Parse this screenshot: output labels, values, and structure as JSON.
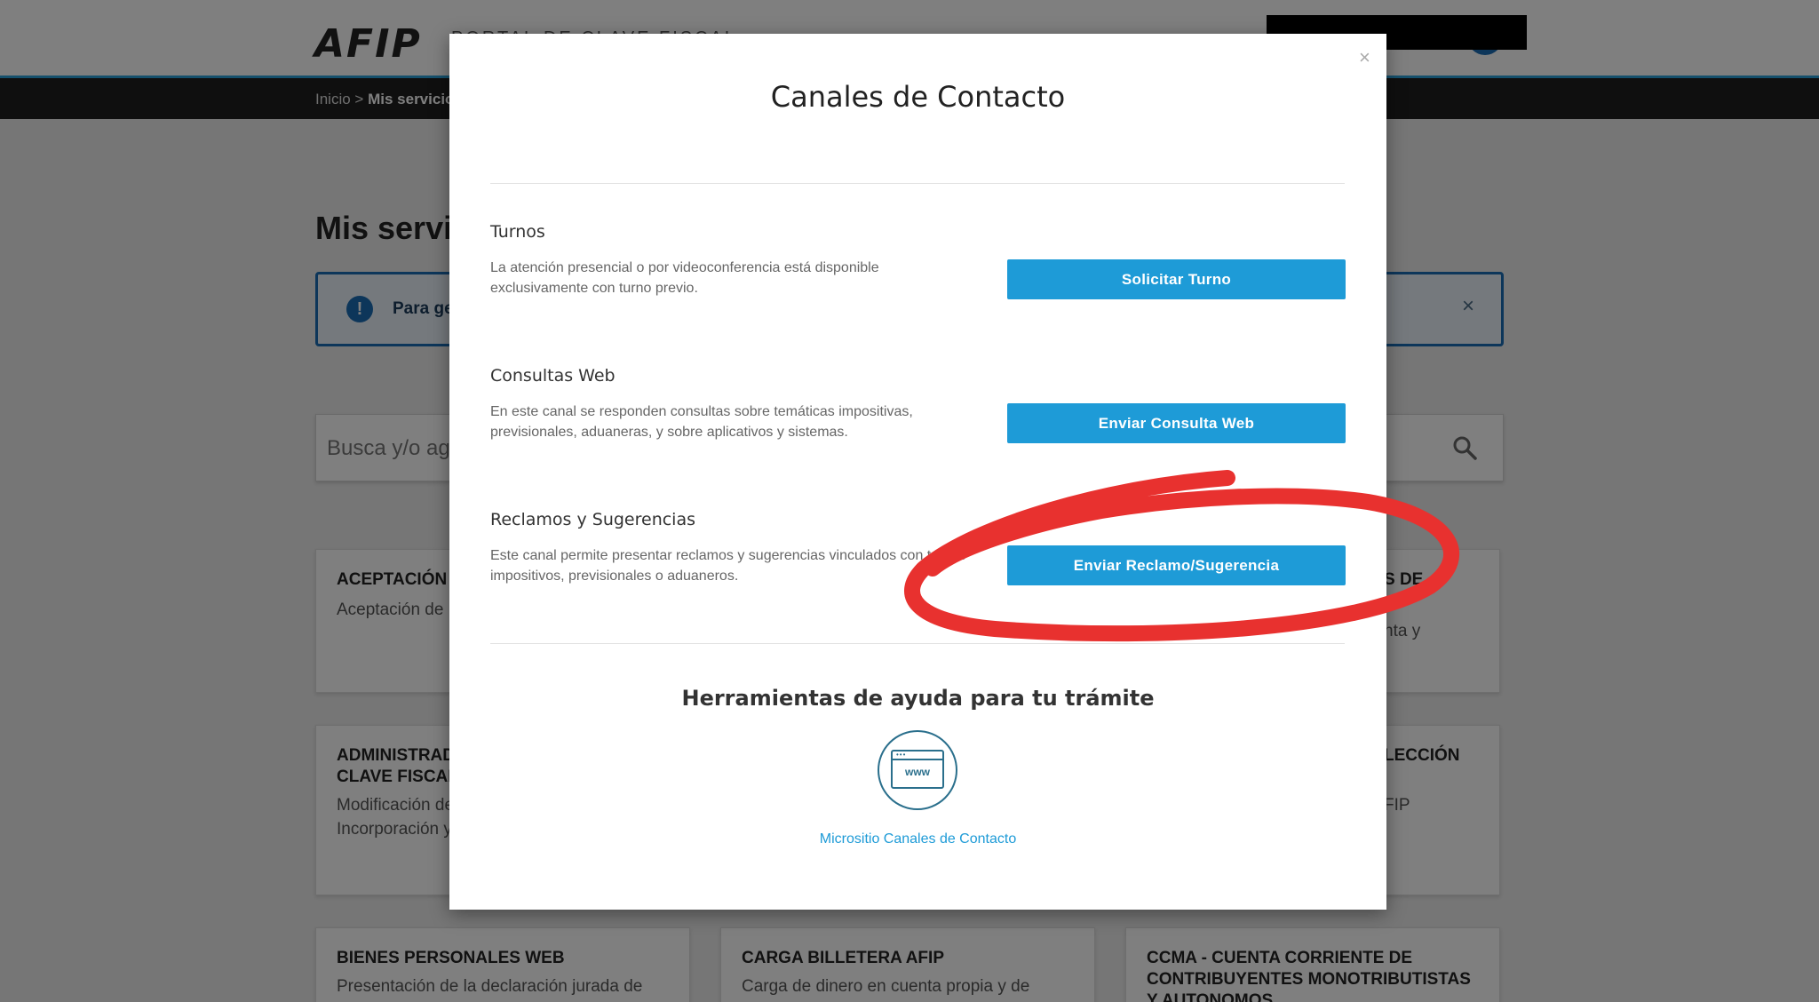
{
  "header": {
    "logo": "AFIP",
    "portal_title": "PORTAL DE CLAVE FISCAL"
  },
  "breadcrumb": {
    "home": "Inicio",
    "separator": ">",
    "current": "Mis servicios"
  },
  "page": {
    "title": "Mis servicios",
    "info_text": "Para ge",
    "info_close": "×",
    "search_placeholder": "Busca y/o ag"
  },
  "cards": [
    {
      "title": "ACEPTACIÓN",
      "desc": "Aceptación de"
    },
    {
      "title": "S DE",
      "desc": "nta y"
    },
    {
      "title": "ADMINISTRADOR DE RELACIONES DE CLAVE FISCAL",
      "desc": "Modificación de perfil. Incorporación y"
    },
    {
      "title": "LECCIÓN",
      "desc": "FIP"
    },
    {
      "title": "BIENES PERSONALES WEB",
      "desc": "Presentación de la declaración jurada de"
    },
    {
      "title": "CARGA BILLETERA AFIP",
      "desc": "Carga de dinero en cuenta propia y de"
    },
    {
      "title": "CCMA - CUENTA CORRIENTE DE CONTRIBUYENTES MONOTRIBUTISTAS Y AUTONOMOS",
      "desc": ""
    }
  ],
  "modal": {
    "title": "Canales de Contacto",
    "close": "×",
    "sections": [
      {
        "title": "Turnos",
        "desc": "La atención presencial o por videoconferencia está disponible exclusivamente con turno previo.",
        "button": "Solicitar Turno"
      },
      {
        "title": "Consultas Web",
        "desc": "En este canal se responden consultas sobre temáticas impositivas, previsionales, aduaneras, y sobre aplicativos y sistemas.",
        "button": "Enviar Consulta Web"
      },
      {
        "title": "Reclamos y Sugerencias",
        "desc": "Este canal permite presentar reclamos y sugerencias vinculados con temas impositivos, previsionales o aduaneros.",
        "button": "Enviar Reclamo/Sugerencia"
      }
    ],
    "help_title": "Herramientas de ayuda para tu trámite",
    "help_icon_text": "www",
    "help_link": "Micrositio Canales de Contacto"
  },
  "colors": {
    "accent": "#1e9bd7",
    "annotation": "#e8312f",
    "dark_bar": "#1f1f1f"
  }
}
